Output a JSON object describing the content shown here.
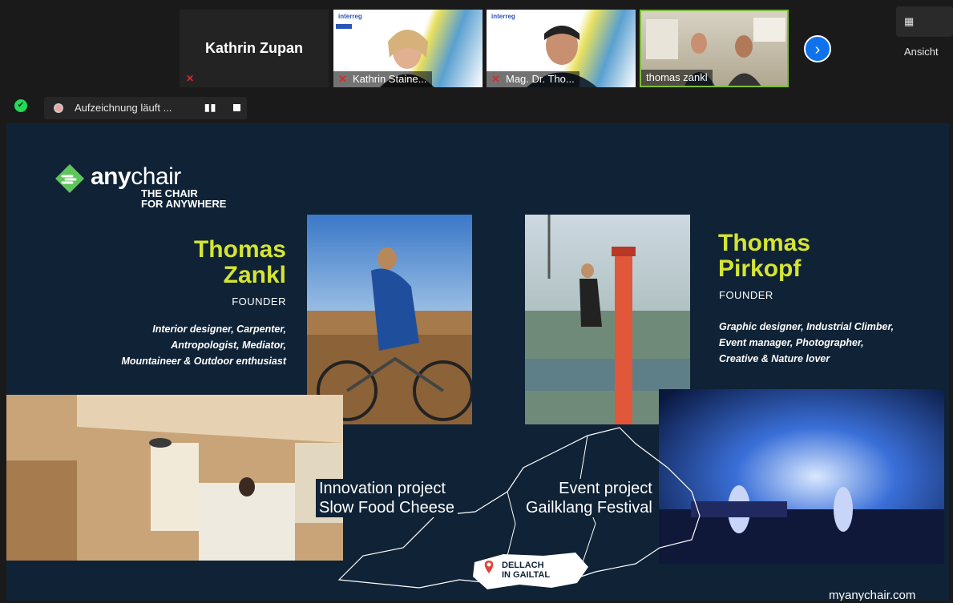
{
  "meeting": {
    "active_speaker": "Kathrin Zupan",
    "participants": [
      {
        "name": "Kathrin Staine...",
        "muted": true
      },
      {
        "name": "Mag. Dr. Tho...",
        "muted": true
      },
      {
        "name": "thomas zankl",
        "muted": false
      }
    ],
    "view_button": "Ansicht",
    "next_icon": "chevron-right-icon"
  },
  "recording": {
    "status": "Aufzeichnung läuft ...",
    "pause_icon": "pause-icon",
    "stop_icon": "stop-icon"
  },
  "slide": {
    "logo": {
      "word_prefix": "any",
      "word_suffix": "chair",
      "tagline_1": "THE CHAIR",
      "tagline_2": "FOR ANYWHERE"
    },
    "person1": {
      "first": "Thomas",
      "last": "Zankl",
      "role": "FOUNDER",
      "bio": [
        "Interior designer, Carpenter,",
        "Antropologist, Mediator,",
        "Mountaineer & Outdoor enthusiast"
      ]
    },
    "person2": {
      "first": "Thomas",
      "last": "Pirkopf",
      "role": "FOUNDER",
      "bio": [
        "Graphic designer, Industrial Climber,",
        "Event manager, Photographer,",
        "Creative & Nature lover"
      ]
    },
    "project1": {
      "line1": "Innovation project",
      "line2": "Slow Food Cheese"
    },
    "project2": {
      "line1": "Event project",
      "line2": "Gailklang Festival"
    },
    "location": {
      "line1": "DELLACH",
      "line2": "IN GAILTAL"
    },
    "url": "myanychair.com"
  },
  "colors": {
    "slide_bg": "#0f2236",
    "accent": "#d4e532",
    "logo_green": "#5ec55a",
    "zoom_blue": "#0e72ed"
  }
}
